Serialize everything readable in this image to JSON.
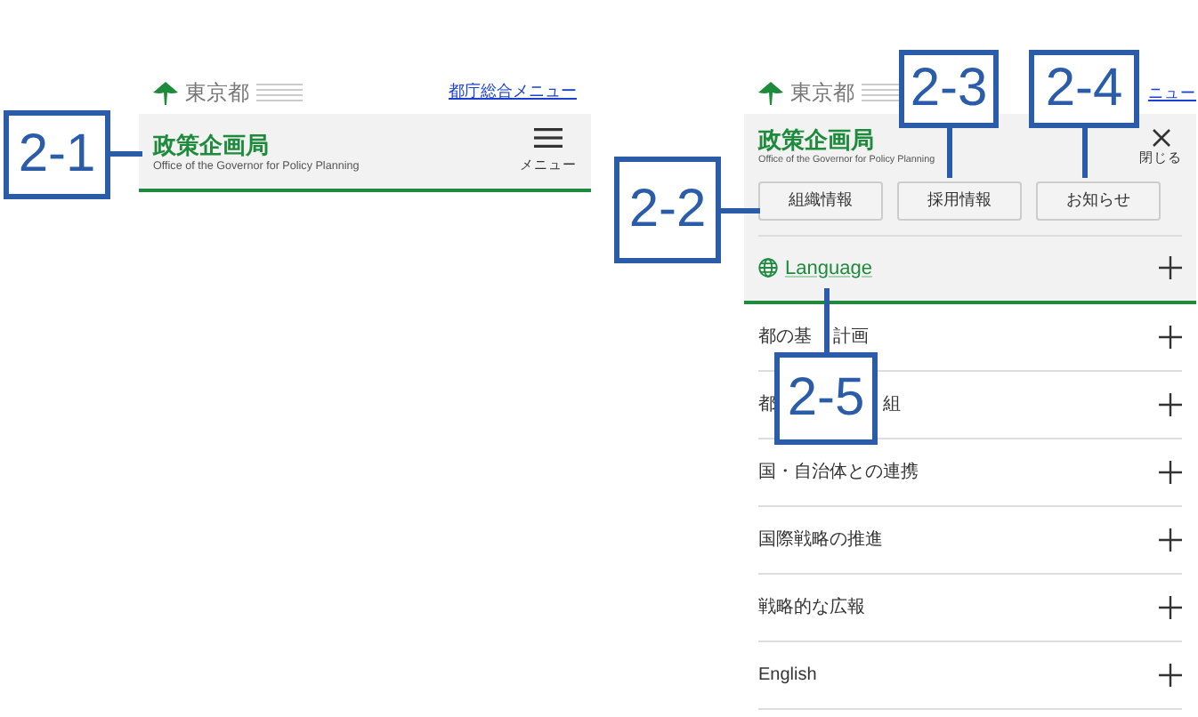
{
  "closed_view": {
    "logo_text": "東京都",
    "top_link": "都庁総合メニュー",
    "title": "政策企画局",
    "subtitle": "Office of the Governor for Policy Planning",
    "menu_label": "メニュー"
  },
  "open_view": {
    "logo_text": "東京都",
    "top_link": "ニュー",
    "title": "政策企画局",
    "subtitle": "Office of the Governor for Policy Planning",
    "close_label": "閉じる",
    "buttons": [
      "組織情報",
      "採用情報",
      "お知らせ"
    ],
    "language": "Language",
    "menu_items": [
      {
        "parts": [
          "都の基",
          "計画"
        ]
      },
      {
        "parts": [
          "都",
          "組"
        ]
      },
      {
        "parts": [
          "国・自治体との連携"
        ]
      },
      {
        "parts": [
          "国際戦略の推進"
        ]
      },
      {
        "parts": [
          "戦略的な広報"
        ]
      },
      {
        "parts": [
          "English"
        ]
      }
    ]
  },
  "callouts": [
    {
      "label": "2-1"
    },
    {
      "label": "2-2"
    },
    {
      "label": "2-3"
    },
    {
      "label": "2-4"
    },
    {
      "label": "2-5"
    }
  ]
}
